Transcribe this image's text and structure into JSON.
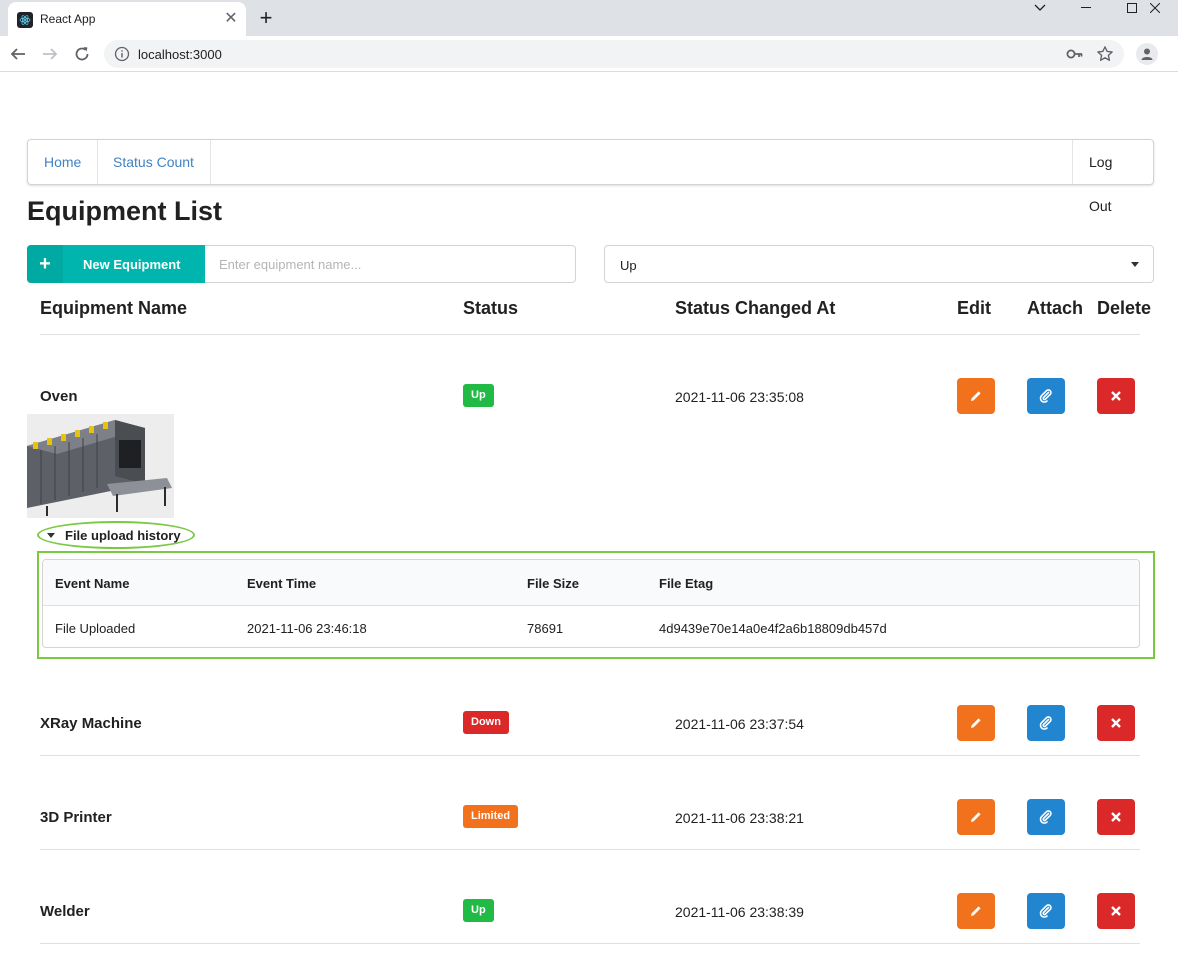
{
  "browser": {
    "tab_title": "React App",
    "url": "localhost:3000"
  },
  "nav": {
    "home": "Home",
    "status_count": "Status Count",
    "logout": "Log Out"
  },
  "page": {
    "title": "Equipment List",
    "new_button_label": "New Equipment",
    "name_placeholder": "Enter equipment name...",
    "status_filter_value": "Up"
  },
  "table": {
    "headers": {
      "name": "Equipment Name",
      "status": "Status",
      "changed_at": "Status Changed At",
      "edit": "Edit",
      "attach": "Attach",
      "delete": "Delete"
    },
    "rows": [
      {
        "name": "Oven",
        "status": "Up",
        "changed_at": "2021-11-06 23:35:08"
      },
      {
        "name": "XRay Machine",
        "status": "Down",
        "changed_at": "2021-11-06 23:37:54"
      },
      {
        "name": "3D Printer",
        "status": "Limited",
        "changed_at": "2021-11-06 23:38:21"
      },
      {
        "name": "Welder",
        "status": "Up",
        "changed_at": "2021-11-06 23:38:39"
      }
    ]
  },
  "history": {
    "toggle_label": "File upload history",
    "headers": {
      "event_name": "Event Name",
      "event_time": "Event Time",
      "file_size": "File Size",
      "file_etag": "File Etag"
    },
    "rows": [
      {
        "event_name": "File Uploaded",
        "event_time": "2021-11-06 23:46:18",
        "file_size": "78691",
        "file_etag": "4d9439e70e14a0e4f2a6b18809db457d"
      }
    ]
  },
  "colors": {
    "teal": "#00b5ad",
    "up": "#21ba45",
    "down": "#db2828",
    "limited": "#f2711c",
    "edit": "#f2711c",
    "attach": "#2185d0",
    "delete": "#db2828",
    "highlight": "#7ac943"
  },
  "icons": {
    "edit": "pencil-icon",
    "attach": "paperclip-icon",
    "delete": "close-icon",
    "new": "plus-icon"
  }
}
